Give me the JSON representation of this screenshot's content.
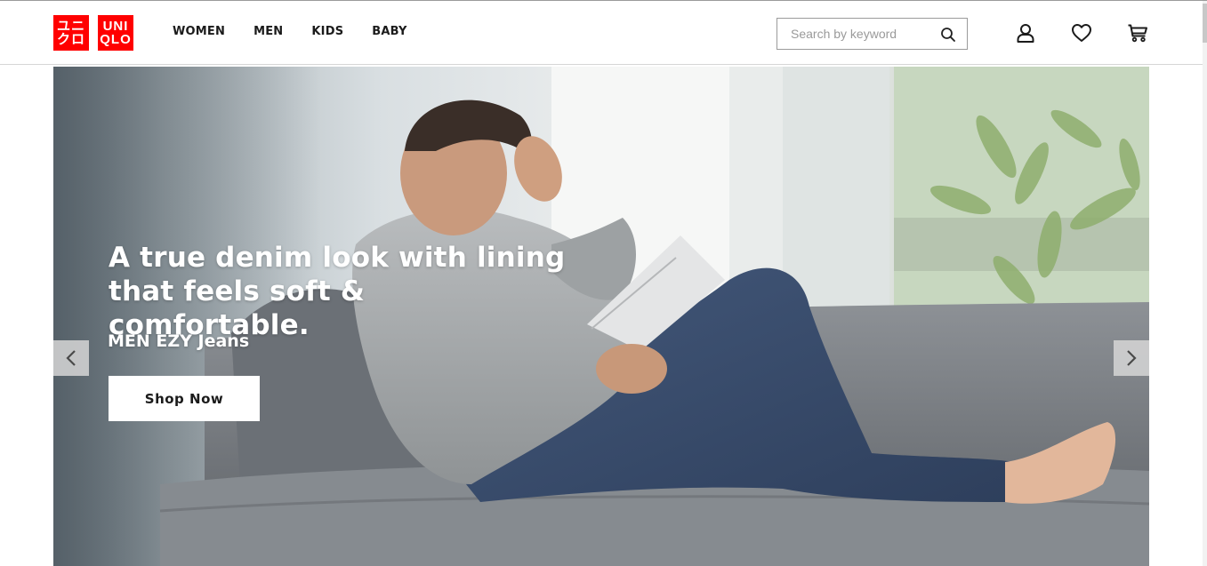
{
  "brand": {
    "logo_left_line1": "ユニ",
    "logo_left_line2": "クロ",
    "logo_right_line1": "UNI",
    "logo_right_line2": "QLO",
    "color": "#ff0000"
  },
  "nav": {
    "items": [
      {
        "label": "WOMEN"
      },
      {
        "label": "MEN"
      },
      {
        "label": "KIDS"
      },
      {
        "label": "BABY"
      }
    ]
  },
  "search": {
    "placeholder": "Search by keyword",
    "icon": "search-icon"
  },
  "header_icons": [
    "account-icon",
    "wishlist-heart-icon",
    "cart-icon"
  ],
  "hero": {
    "title": "A true denim look with lining\nthat feels soft & comfortable.",
    "subtitle": "MEN EZY Jeans",
    "cta_label": "Shop Now",
    "prev_icon": "chevron-left-icon",
    "next_icon": "chevron-right-icon"
  }
}
